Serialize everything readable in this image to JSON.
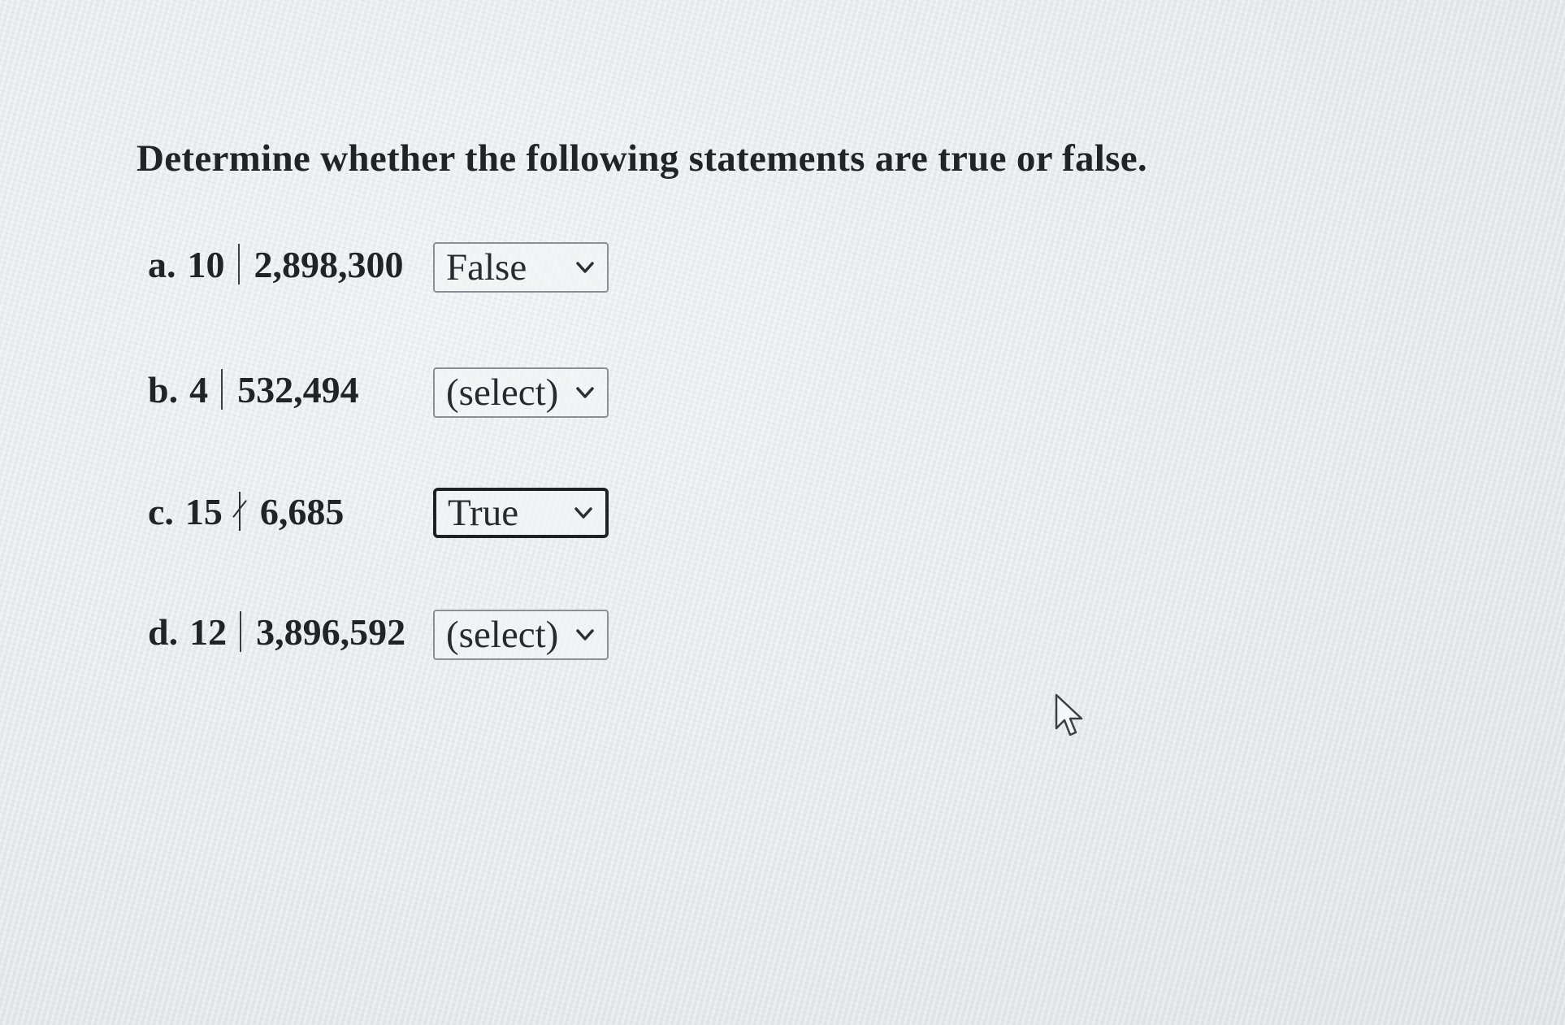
{
  "prompt": "Determine whether the following statements are true or false.",
  "items": [
    {
      "letter": "a.",
      "divisor": "10",
      "relation": "divides",
      "dividend": "2,898,300",
      "selected": "False"
    },
    {
      "letter": "b.",
      "divisor": "4",
      "relation": "divides",
      "dividend": "532,494",
      "selected": "(select)"
    },
    {
      "letter": "c.",
      "divisor": "15",
      "relation": "does-not-divide",
      "dividend": "6,685",
      "selected": "True"
    },
    {
      "letter": "d.",
      "divisor": "12",
      "relation": "divides",
      "dividend": "3,896,592",
      "selected": "(select)"
    }
  ],
  "icons": {
    "dropdown": "chevron-down-icon",
    "pointer": "mouse-cursor-icon"
  }
}
